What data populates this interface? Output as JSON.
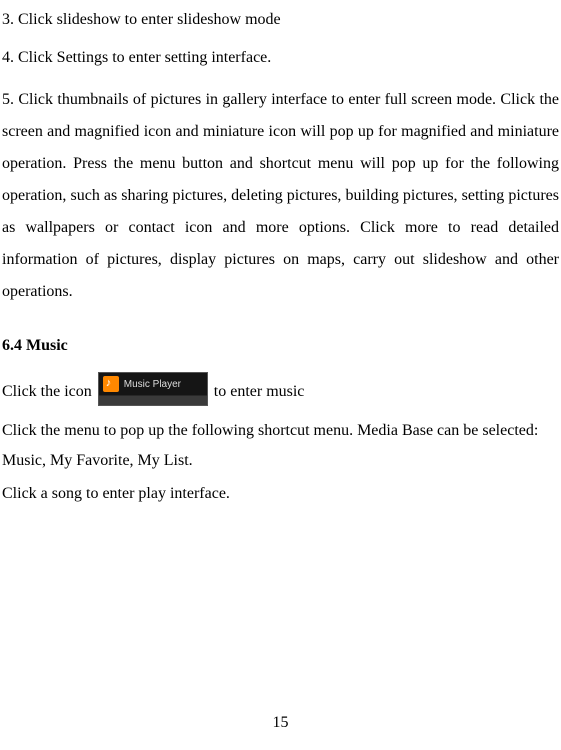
{
  "para1": "3. Click slideshow to enter slideshow mode",
  "para2": "4. Click Settings to enter setting interface.",
  "para3": "5. Click thumbnails of pictures in gallery interface to enter full screen mode. Click the screen and magnified icon and miniature icon will pop up for magnified and miniature operation. Press the menu button and shortcut menu will pop up for the following operation, such as sharing pictures, deleting pictures, building pictures, setting pictures as wallpapers or contact icon and more options. Click more to read detailed information of pictures, display pictures on maps, carry out slideshow and other operations.",
  "heading": "6.4 Music",
  "iconline_before": "Click the icon",
  "iconline_after": " to enter music",
  "icon_label": "Music Player",
  "para5": "Click the menu to pop up the following shortcut menu. Media Base can be selected: Music, My Favorite, My List.",
  "para6": "Click a song to enter play interface.",
  "page_number": "15"
}
